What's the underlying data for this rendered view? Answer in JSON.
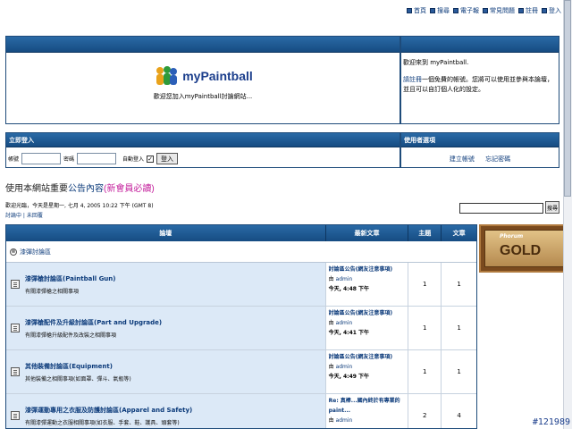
{
  "topnav": [
    {
      "label": "首頁",
      "icon": "home-icon"
    },
    {
      "label": "搜尋",
      "icon": "search-icon"
    },
    {
      "label": "電子報",
      "icon": "newsletter-icon"
    },
    {
      "label": "常見問題",
      "icon": "faq-icon"
    },
    {
      "label": "註冊",
      "icon": "register-icon"
    },
    {
      "label": "登入",
      "icon": "login-icon"
    }
  ],
  "banner": {
    "logo_text": "myPaintball",
    "tagline": "歡迎您加入myPaintball討論網站..."
  },
  "welcome": {
    "greeting": "歡迎來到 myPaintball.",
    "register_link": "請註冊",
    "message": "一個免費的帳號。您將可以使用並參與本論壇，並且可以自訂個人化的設定。"
  },
  "login": {
    "header": "立即登入",
    "username_label": "帳號",
    "password_label": "密碼",
    "autologin_label": "自動登入",
    "autologin_checked": "✓",
    "submit_label": "登入"
  },
  "user_panel": {
    "header": "使用者選項",
    "create_account": "建立帳號",
    "forgot_password": "忘記密碼"
  },
  "notice": {
    "prefix": "使用本網站重要",
    "link": "公告內容",
    "pink": "(新會員必讀)"
  },
  "status": {
    "line1": "歡迎光臨，今天是星期一, 七月 4, 2005 10:22 下午 (GMT 8)",
    "line2": "討論中 | 未回覆"
  },
  "search": {
    "button": "搜尋"
  },
  "table": {
    "headers": {
      "forum": "論壇",
      "latest": "最新文章",
      "topics": "主題",
      "posts": "文章"
    },
    "category": "漆彈討論區",
    "rows": [
      {
        "title": "漆彈槍討論區(Paintball Gun)",
        "desc": "有關漆彈槍之相關事項",
        "latest_title": "討論區公告(網友注意事項)",
        "by_prefix": "由",
        "author": "admin",
        "time": "今天, 4:48 下午",
        "topics": "1",
        "posts": "1"
      },
      {
        "title": "漆彈槍配件及升級討論區(Part and Upgrade)",
        "desc": "有關漆彈槍升級配件及改裝之相關事項",
        "latest_title": "討論區公告(網友注意事項)",
        "by_prefix": "由",
        "author": "admin",
        "time": "今天, 4:41 下午",
        "topics": "1",
        "posts": "1"
      },
      {
        "title": "其他裝備討論區(Equipment)",
        "desc": "其他裝備之相關事項(如面罩、彈斗、氣瓶等)",
        "latest_title": "討論區公告(網友注意事項)",
        "by_prefix": "由",
        "author": "admin",
        "time": "今天, 4:49 下午",
        "topics": "1",
        "posts": "1"
      },
      {
        "title": "漆彈運動專用之衣服及防護討論區(Apparel and Safety)",
        "desc": "有關漆彈運動之衣服相關事項(如衣服、手套、鞋、護具、頭套等)",
        "latest_title": "Re: 真棒...國內終於有專業的paint...",
        "by_prefix": "由",
        "author": "admin",
        "time": "",
        "topics": "2",
        "posts": "4"
      }
    ]
  },
  "badge": {
    "small": "Phorum",
    "big": "GOLD"
  },
  "corner_id": "#121989"
}
